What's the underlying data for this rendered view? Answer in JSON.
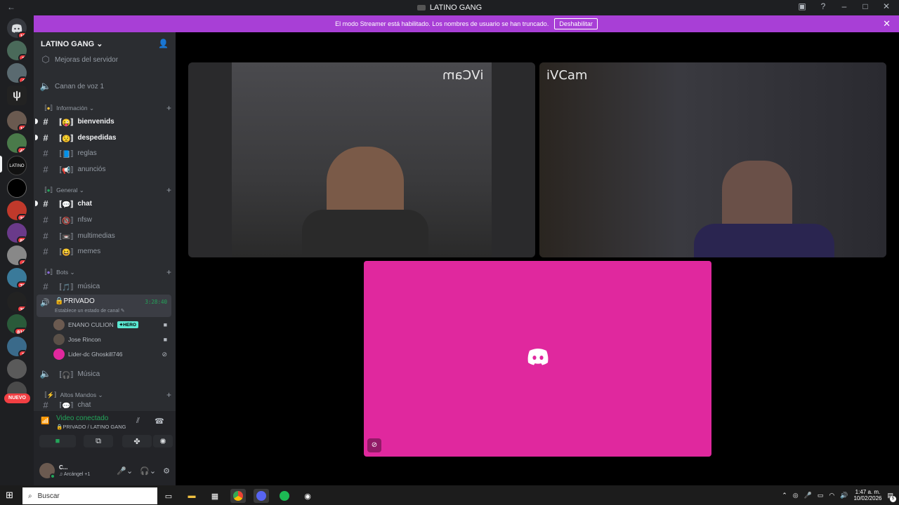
{
  "titlebar": {
    "title": "LATINO GANG"
  },
  "banner": {
    "text": "El modo Streamer está habilitado. Los nombres de usuario se han truncado.",
    "button": "Deshabilitar"
  },
  "guilds": {
    "badges": [
      "11",
      "2",
      "4",
      "11",
      "47",
      "23",
      "85",
      "4",
      "72",
      "39",
      "816",
      "2"
    ],
    "new_label": "NUEVO"
  },
  "server": {
    "name": "LATINO GANG"
  },
  "channels": {
    "boost": "Mejoras del servidor",
    "voice1": "Canan de voz 1",
    "cat_info": "Información",
    "bienvenids": "bienvenids",
    "despedidas": "despedidas",
    "reglas": "reglas",
    "anuncios": "anunciós",
    "cat_general": "General",
    "chat": "chat",
    "nfsw": "nfsw",
    "multimedias": "multimedias",
    "memes": "memes",
    "cat_bots": "Bots",
    "musica": "música",
    "privado": "PRIVADO",
    "privado_status": "Establece un estado de canal",
    "privado_timer": "3:28:40",
    "musica_voice": "Música",
    "cat_altos": "Altos Mandos",
    "partial": "chat"
  },
  "voice_users": [
    {
      "name": "ENANO CULION",
      "tag": "HERO"
    },
    {
      "name": "Jose Rincon"
    },
    {
      "name": "Lider-dc Ghoskill746"
    }
  ],
  "rtc": {
    "status": "Video conectado",
    "location": "PRIVADO / LATINO GANG"
  },
  "user": {
    "name": "C...",
    "activity": "Arcángel +1"
  },
  "stage": {
    "cam_left": "iVCam",
    "cam_right": "iVCam"
  },
  "taskbar": {
    "search_placeholder": "Buscar",
    "time": "1:47 a. m.",
    "date": "10/02/2026",
    "notif_count": "5"
  },
  "colors": {
    "banner": "#a83fd6",
    "pink_tile": "#e0289e",
    "online": "#23a55a"
  }
}
